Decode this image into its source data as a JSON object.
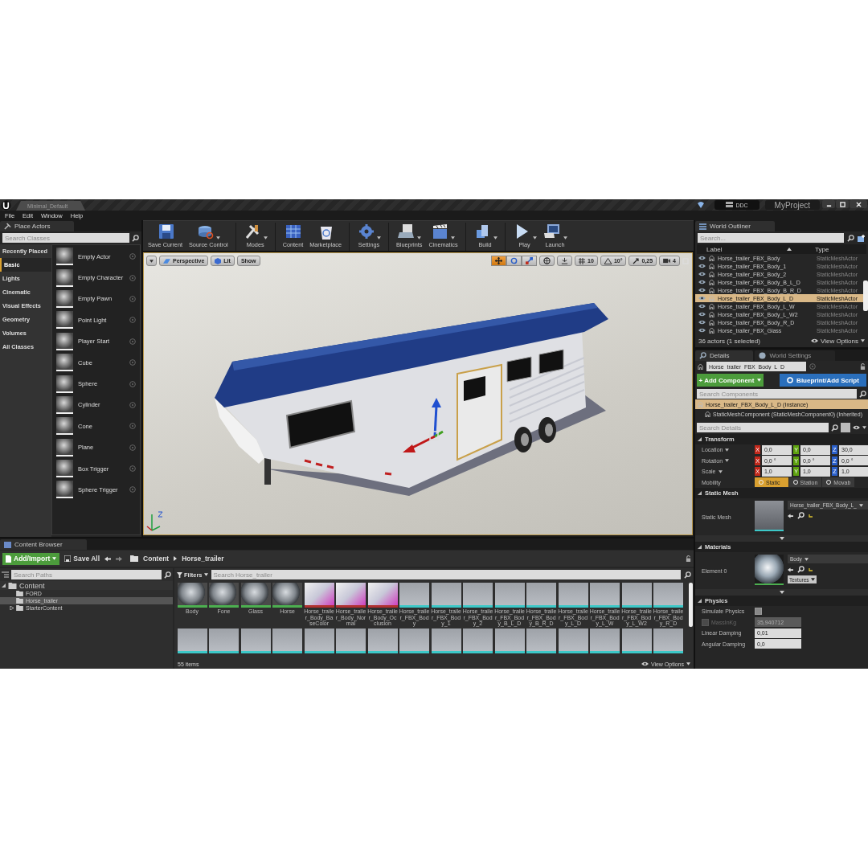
{
  "title_bar": {
    "tab": "Minimal_Default",
    "ddc": "DDC",
    "project": "MyProject"
  },
  "menu": [
    "File",
    "Edit",
    "Window",
    "Help"
  ],
  "place_actors": {
    "title": "Place Actors",
    "placeholder": "Search Classes",
    "categories": [
      {
        "label": "Recently Placed",
        "selected": false
      },
      {
        "label": "Basic",
        "selected": true
      },
      {
        "label": "Lights",
        "selected": false
      },
      {
        "label": "Cinematic",
        "selected": false
      },
      {
        "label": "Visual Effects",
        "selected": false
      },
      {
        "label": "Geometry",
        "selected": false
      },
      {
        "label": "Volumes",
        "selected": false
      },
      {
        "label": "All Classes",
        "selected": false
      }
    ],
    "items": [
      "Empty Actor",
      "Empty Character",
      "Empty Pawn",
      "Point Light",
      "Player Start",
      "Cube",
      "Sphere",
      "Cylinder",
      "Cone",
      "Plane",
      "Box Trigger",
      "Sphere Trigger"
    ]
  },
  "toolbar": [
    {
      "label": "Save Current",
      "dropdown": false
    },
    {
      "label": "Source Control",
      "dropdown": true
    },
    {
      "label": "Modes",
      "dropdown": true
    },
    {
      "label": "Content",
      "dropdown": false
    },
    {
      "label": "Marketplace",
      "dropdown": false
    },
    {
      "label": "Settings",
      "dropdown": true
    },
    {
      "label": "Blueprints",
      "dropdown": true
    },
    {
      "label": "Cinematics",
      "dropdown": true
    },
    {
      "label": "Build",
      "dropdown": true
    },
    {
      "label": "Play",
      "dropdown": true
    },
    {
      "label": "Launch",
      "dropdown": true
    }
  ],
  "viewport": {
    "buttons": [
      "Perspective",
      "Lit",
      "Show"
    ],
    "transform_modes": [
      {
        "selected": true
      },
      {
        "selected": false
      },
      {
        "selected": false
      }
    ],
    "grid_snap": "10",
    "rotation_snap": "10°",
    "scale_snap": "0,25",
    "camera_speed": "4"
  },
  "world_outliner": {
    "title": "World Outliner",
    "placeholder": "Search...",
    "columns": [
      "Label",
      "Type"
    ],
    "rows": [
      {
        "label": "Horse_trailer_FBX_Body",
        "type": "StaticMeshActor",
        "selected": false
      },
      {
        "label": "Horse_trailer_FBX_Body_1",
        "type": "StaticMeshActor",
        "selected": false
      },
      {
        "label": "Horse_trailer_FBX_Body_2",
        "type": "StaticMeshActor",
        "selected": false
      },
      {
        "label": "Horse_trailer_FBX_Body_B_L_D",
        "type": "StaticMeshActor",
        "selected": false
      },
      {
        "label": "Horse_trailer_FBX_Body_B_R_D",
        "type": "StaticMeshActor",
        "selected": false
      },
      {
        "label": "Horse_trailer_FBX_Body_L_D",
        "type": "StaticMeshActor",
        "selected": true
      },
      {
        "label": "Horse_trailer_FBX_Body_L_W",
        "type": "StaticMeshActor",
        "selected": false
      },
      {
        "label": "Horse_trailer_FBX_Body_L_W2",
        "type": "StaticMeshActor",
        "selected": false
      },
      {
        "label": "Horse_trailer_FBX_Body_R_D",
        "type": "StaticMeshActor",
        "selected": false
      },
      {
        "label": "Horse_trailer_FBX_Glass",
        "type": "StaticMeshActor",
        "selected": false
      }
    ],
    "status": "36 actors (1 selected)",
    "view_options": "View Options"
  },
  "details": {
    "tabs": [
      {
        "label": "Details",
        "selected": true
      },
      {
        "label": "World Settings",
        "selected": false
      }
    ],
    "actor_name": "Horse_trailer_FBX_Body_L_D",
    "add_component": "+ Add Component",
    "blueprint": "Blueprint/Add Script",
    "components_placeholder": "Search Components",
    "components": [
      {
        "label": "Horse_trailer_FBX_Body_L_D (Instance)",
        "selected": true
      },
      {
        "label": "StaticMeshComponent (StaticMeshComponent0) (Inherited)",
        "selected": false
      }
    ],
    "details_placeholder": "Search Details",
    "sections": [
      {
        "kind": "transform",
        "title": "Transform",
        "expanded": true,
        "rows": [
          {
            "label": "Location",
            "values": [
              {
                "axis": "X",
                "value": "0,0",
                "color": "#c3291c"
              },
              {
                "axis": "Y",
                "value": "0,0",
                "color": "#5ea20f"
              },
              {
                "axis": "Z",
                "value": "30,0",
                "color": "#2a5fc9"
              }
            ]
          },
          {
            "label": "Rotation",
            "values": [
              {
                "axis": "X",
                "value": "0,0 °",
                "color": "#c3291c"
              },
              {
                "axis": "Y",
                "value": "0,0 °",
                "color": "#5ea20f"
              },
              {
                "axis": "Z",
                "value": "0,0 °",
                "color": "#2a5fc9"
              }
            ]
          },
          {
            "label": "Scale",
            "values": [
              {
                "axis": "X",
                "value": "1,0",
                "color": "#c3291c"
              },
              {
                "axis": "Y",
                "value": "1,0",
                "color": "#5ea20f"
              },
              {
                "axis": "Z",
                "value": "1,0",
                "color": "#2a5fc9"
              }
            ]
          }
        ],
        "mobility": {
          "label": "Mobility",
          "options": [
            {
              "label": "Static",
              "selected": true
            },
            {
              "label": "Station",
              "selected": false
            },
            {
              "label": "Movab",
              "selected": false
            }
          ]
        }
      },
      {
        "kind": "mesh",
        "title": "Static Mesh",
        "expanded": true,
        "label": "Static Mesh",
        "value": "Horse_trailer_FBX_Body_L_"
      },
      {
        "kind": "material",
        "title": "Materials",
        "expanded": true,
        "label": "Element 0",
        "value": "Body",
        "button": "Textures"
      },
      {
        "kind": "properties",
        "title": "Physics",
        "expanded": true,
        "rows": [
          {
            "kind": "checkbox",
            "label": "Simulate Physics",
            "checked": false
          },
          {
            "kind": "number",
            "label": "MassInKg",
            "value": "35,940712",
            "disabled": true,
            "checked": false
          },
          {
            "kind": "number",
            "label": "Linear Damping",
            "value": "0,01",
            "disabled": false
          },
          {
            "kind": "number",
            "label": "Angular Damping",
            "value": "0,0",
            "disabled": false
          }
        ]
      }
    ]
  },
  "content_browser": {
    "title": "Content Browser",
    "add_import": "Add/Import",
    "save_all": "Save All",
    "path": [
      "Content",
      "Horse_trailer"
    ],
    "paths_placeholder": "Search Paths",
    "tree": [
      {
        "label": "Content",
        "expanded": true,
        "selected": false,
        "children": [
          {
            "label": "FORD",
            "selected": false
          },
          {
            "label": "Horse_trailer",
            "selected": true
          },
          {
            "label": "StarterContent",
            "selected": false,
            "expanded": false
          }
        ]
      }
    ],
    "filters": "Filters",
    "search_placeholder": "Search Horse_trailer",
    "assets": [
      {
        "label": "Body",
        "kind": "material"
      },
      {
        "label": "Fone",
        "kind": "material"
      },
      {
        "label": "Glass",
        "kind": "material"
      },
      {
        "label": "Horse",
        "kind": "material"
      },
      {
        "label": "Horse_trailer_Body_BaseColor",
        "kind": "texture"
      },
      {
        "label": "Horse_trailer_Body_Normal",
        "kind": "texture"
      },
      {
        "label": "Horse_trailer_Body_Occlusion",
        "kind": "texture"
      },
      {
        "label": "Horse_trailer_FBX_Body",
        "kind": "mesh"
      },
      {
        "label": "Horse_trailer_FBX_Body_1",
        "kind": "mesh"
      },
      {
        "label": "Horse_trailer_FBX_Body_2",
        "kind": "mesh"
      },
      {
        "label": "Horse_trailer_FBX_Body_B_L_D",
        "kind": "mesh"
      },
      {
        "label": "Horse_trailer_FBX_Body_B_R_D",
        "kind": "mesh"
      },
      {
        "label": "Horse_trailer_FBX_Body_L_D",
        "kind": "mesh"
      },
      {
        "label": "Horse_trailer_FBX_Body_L_W",
        "kind": "mesh"
      },
      {
        "label": "Horse_trailer_FBX_Body_L_W2",
        "kind": "mesh"
      },
      {
        "label": "Horse_trailer_FBX_Body_R_D",
        "kind": "mesh"
      },
      {
        "kind": "mesh"
      },
      {
        "kind": "mesh"
      },
      {
        "kind": "mesh"
      },
      {
        "kind": "mesh"
      },
      {
        "kind": "mesh"
      },
      {
        "kind": "mesh"
      },
      {
        "kind": "mesh"
      },
      {
        "kind": "mesh"
      },
      {
        "kind": "mesh"
      },
      {
        "kind": "mesh"
      },
      {
        "kind": "mesh"
      },
      {
        "kind": "mesh"
      },
      {
        "kind": "mesh"
      },
      {
        "kind": "mesh"
      },
      {
        "kind": "mesh"
      },
      {
        "kind": "mesh"
      }
    ],
    "count": "55 items",
    "view_options": "View Options"
  }
}
